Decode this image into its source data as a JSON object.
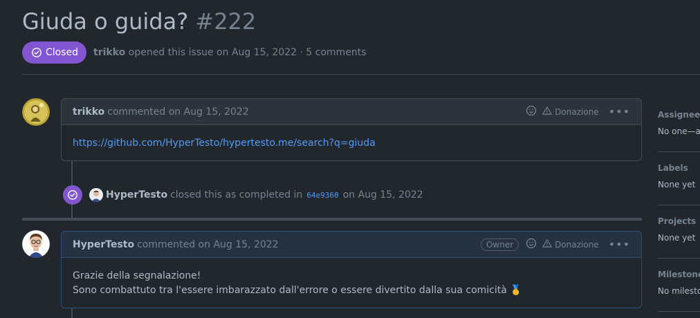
{
  "issue": {
    "title": "Giuda o guida?",
    "number": "#222",
    "state": "Closed",
    "author": "trikko",
    "meta_text": "opened this issue on Aug 15, 2022 · 5 comments"
  },
  "comments": [
    {
      "author": "trikko",
      "when": "commented on Aug 15, 2022",
      "label": "Donazione",
      "body_link": "https://github.com/HyperTesto/hypertesto.me/search?q=giuda"
    },
    {
      "author": "HyperTesto",
      "when": "commented on Aug 15, 2022",
      "role": "Owner",
      "label": "Donazione",
      "body_lines": [
        "Grazie della segnalazione!",
        "Sono combattuto tra l'essere imbarazzato dall'errore o essere divertito dalla sua comicità 🥇"
      ]
    }
  ],
  "event": {
    "actor": "HyperTesto",
    "text": "closed this as completed in",
    "commit": "64e9360",
    "date": "on Aug 15, 2022"
  },
  "sidebar": [
    {
      "label": "Assignees",
      "value": "No one—assign yourself"
    },
    {
      "label": "Labels",
      "value": "None yet"
    },
    {
      "label": "Projects",
      "value": "None yet"
    },
    {
      "label": "Milestone",
      "value": "No milestone"
    }
  ],
  "colors": {
    "closed": "#8256d0",
    "link": "#539bf5",
    "background": "#22272e"
  },
  "icons": {
    "state": "check-circle-icon",
    "reaction": "smiley-icon",
    "warning": "alert-icon",
    "menu": "kebab-icon"
  }
}
